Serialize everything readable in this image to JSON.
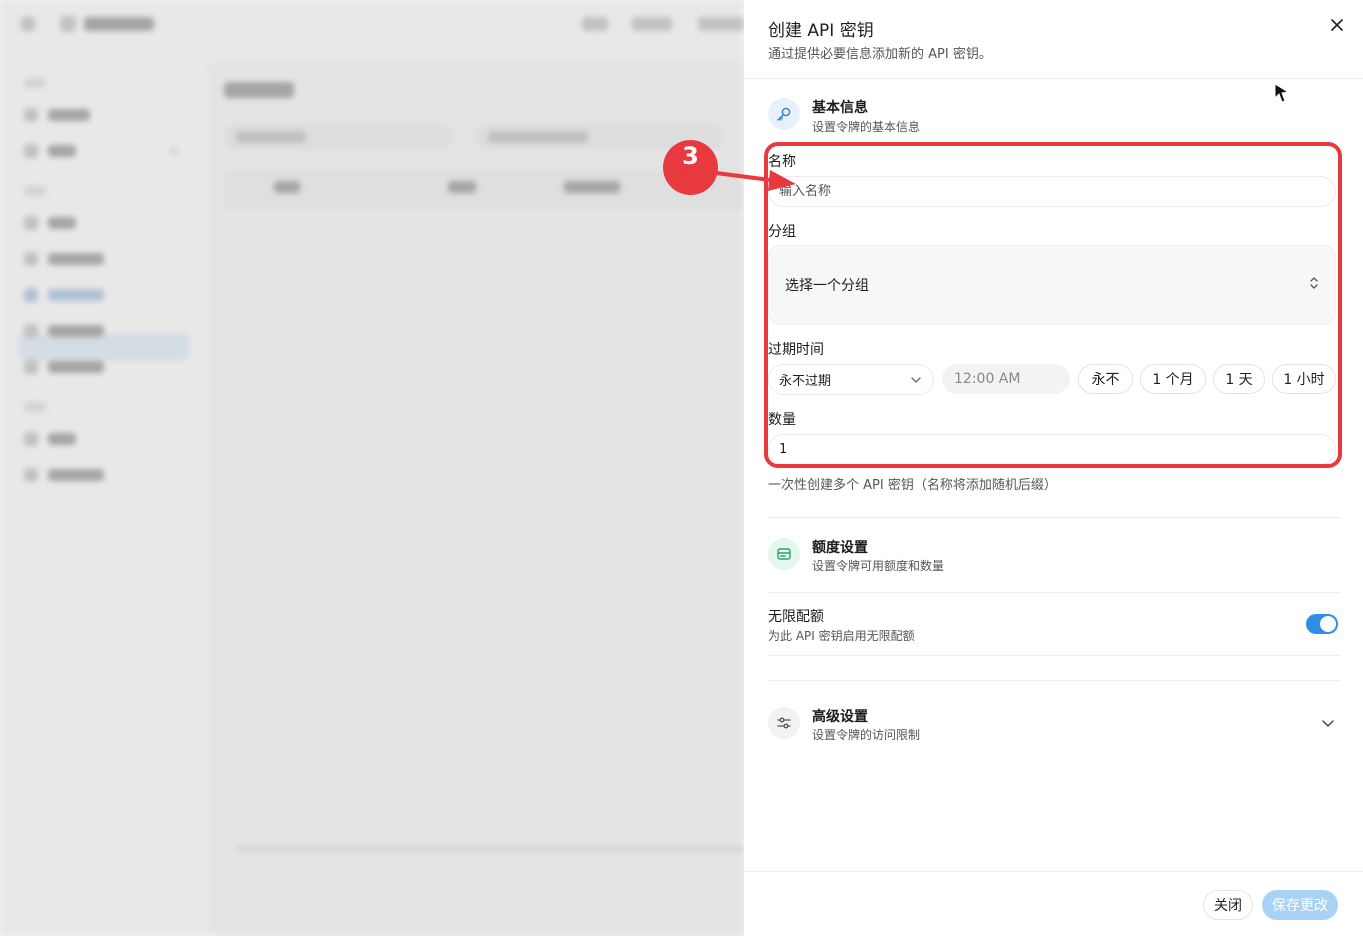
{
  "drawer": {
    "title": "创建 API 密钥",
    "subtitle": "通过提供必要信息添加新的 API 密钥。",
    "close_icon": "close-icon"
  },
  "basic_info": {
    "title": "基本信息",
    "subtitle": "设置令牌的基本信息",
    "icon": "key-icon"
  },
  "form": {
    "name_label": "名称",
    "name_placeholder": "输入名称",
    "group_label": "分组",
    "group_value": "选择一个分组",
    "expire_label": "过期时间",
    "expire_select_value": "永不过期",
    "expire_time_value": "12:00 AM",
    "quick_options": [
      "永不",
      "1 个月",
      "1 天",
      "1 小时"
    ],
    "quantity_label": "数量",
    "quantity_value": "1",
    "quantity_hint": "一次性创建多个 API 密钥（名称将添加随机后缀）"
  },
  "quota": {
    "title": "额度设置",
    "subtitle": "设置令牌可用额度和数量",
    "icon": "wallet-icon",
    "unlimited_label": "无限配额",
    "unlimited_desc": "为此 API 密钥启用无限配额",
    "unlimited_enabled": true
  },
  "advanced": {
    "title": "高级设置",
    "subtitle": "设置令牌的访问限制",
    "icon": "sliders-icon"
  },
  "footer": {
    "close_label": "关闭",
    "save_label": "保存更改"
  },
  "annotation": {
    "badge": "3"
  },
  "colors": {
    "accent": "#2f8fe8",
    "annotation_red": "#e8393e",
    "save_disabled": "#a9d3f5"
  }
}
